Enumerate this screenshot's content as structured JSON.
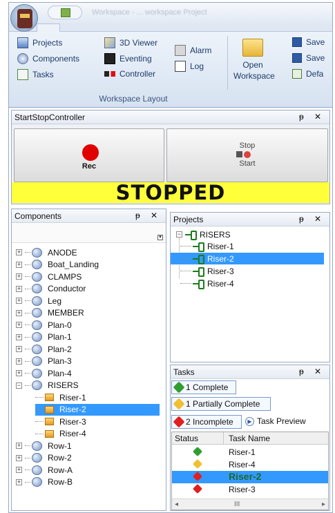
{
  "title": {
    "text": "Workspace - ... workspace Project"
  },
  "ribbon": {
    "items": [
      {
        "label": "Projects",
        "icon": "projects-icon"
      },
      {
        "label": "Components",
        "icon": "components-icon"
      },
      {
        "label": "Tasks",
        "icon": "tasks-icon"
      },
      {
        "label": "3D Viewer",
        "icon": "3d-viewer-icon"
      },
      {
        "label": "Eventing",
        "icon": "eventing-icon"
      },
      {
        "label": "Controller",
        "icon": "controller-icon"
      },
      {
        "label": "Alarm",
        "icon": "alarm-icon"
      },
      {
        "label": "Log",
        "icon": "log-icon"
      }
    ],
    "open_workspace": "Open\nWorkspace",
    "save_items": [
      "Save",
      "Save",
      "Defa"
    ],
    "group_label": "Workspace Layout"
  },
  "ssc": {
    "title": "StartStopController",
    "rec_label": "Rec",
    "stop_label": "Stop",
    "start_label": "Start",
    "status": "STOPPED",
    "status_color": "#ffff3a"
  },
  "components": {
    "title": "Components",
    "items": [
      {
        "label": "ANODE",
        "expanded": false
      },
      {
        "label": "Boat_Landing",
        "expanded": false
      },
      {
        "label": "CLAMPS",
        "expanded": false
      },
      {
        "label": "Conductor",
        "expanded": false
      },
      {
        "label": "Leg",
        "expanded": false
      },
      {
        "label": "MEMBER",
        "expanded": false
      },
      {
        "label": "Plan-0",
        "expanded": false
      },
      {
        "label": "Plan-1",
        "expanded": false
      },
      {
        "label": "Plan-2",
        "expanded": false
      },
      {
        "label": "Plan-3",
        "expanded": false
      },
      {
        "label": "Plan-4",
        "expanded": false
      },
      {
        "label": "RISERS",
        "expanded": true
      },
      {
        "label": "Riser-1",
        "child": true
      },
      {
        "label": "Riser-2",
        "child": true,
        "selected": true
      },
      {
        "label": "Riser-3",
        "child": true
      },
      {
        "label": "Riser-4",
        "child": true
      },
      {
        "label": "Row-1",
        "expanded": false
      },
      {
        "label": "Row-2",
        "expanded": false
      },
      {
        "label": "Row-A",
        "expanded": false
      },
      {
        "label": "Row-B",
        "expanded": false
      }
    ]
  },
  "projects": {
    "title": "Projects",
    "root": "RISERS",
    "items": [
      {
        "label": "Riser-1"
      },
      {
        "label": "Riser-2",
        "selected": true
      },
      {
        "label": "Riser-3"
      },
      {
        "label": "Riser-4"
      }
    ]
  },
  "tasks": {
    "title": "Tasks",
    "filters": [
      {
        "label": "1 Complete",
        "color": "#2f9e2f"
      },
      {
        "label": "1 Partially Complete",
        "color": "#f0c030"
      },
      {
        "label": "2 Incomplete",
        "color": "#e02020"
      }
    ],
    "preview_label": "Task Preview",
    "col_status": "Status",
    "col_name": "Task Name",
    "rows": [
      {
        "name": "Riser-1",
        "color": "#2f9e2f"
      },
      {
        "name": "Riser-4",
        "color": "#f0c030"
      },
      {
        "name": "Riser-2",
        "color": "#e02020",
        "selected": true
      },
      {
        "name": "Riser-3",
        "color": "#e02020"
      }
    ],
    "scroll_label": "III"
  },
  "pane_controls": "ᵽ ✕"
}
